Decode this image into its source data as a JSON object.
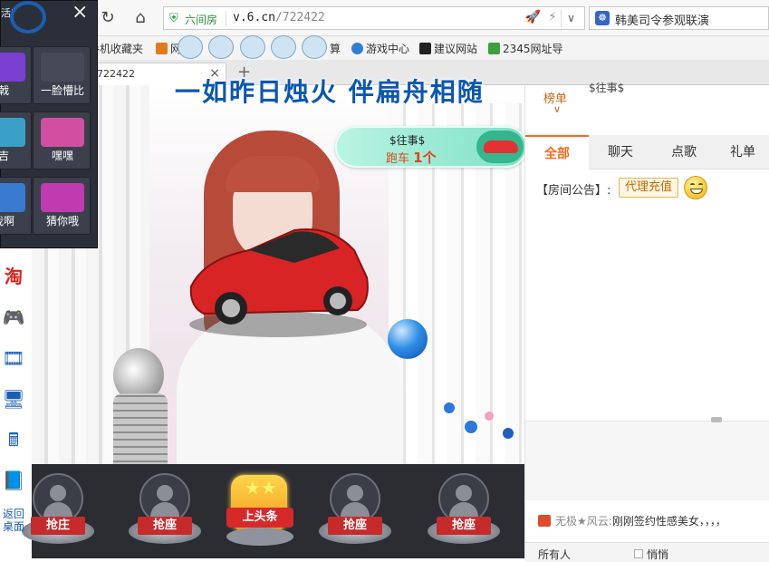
{
  "browser": {
    "site_badge": "六间房",
    "url_host": "v.6.cn",
    "url_path": "/722422",
    "search_text": "韩美司令参观联演",
    "tab_title": "722422"
  },
  "bookmarks": [
    {
      "label": "手机收藏夹",
      "color": "#888888"
    },
    {
      "label": "网",
      "color": "#e07b1a"
    },
    {
      "label": "算",
      "color": "#e07b1a"
    },
    {
      "label": "游戏中心",
      "color": "#2f7fd6"
    },
    {
      "label": "建议网站",
      "color": "#222222"
    },
    {
      "label": "2345网址导",
      "color": "#3ca03c"
    }
  ],
  "emoji_panel": {
    "title_fragment": "活)",
    "items": [
      {
        "caption": "戟",
        "color": "#7b3fd1"
      },
      {
        "caption": "一脸懵比",
        "color": "#e8e8e8"
      },
      {
        "caption": "吉",
        "color": "#3aa0c8"
      },
      {
        "caption": "嘿嘿",
        "color": "#d04fa0"
      },
      {
        "caption": "我啊",
        "color": "#3a7bd1"
      },
      {
        "caption": "猜你哦",
        "color": "#c03ab0"
      }
    ]
  },
  "stream": {
    "banner_title": "一如昨日烛火 伴扁舟相随",
    "race_user": "$往事$",
    "race_action": "跑车",
    "race_count": "1个"
  },
  "seats": [
    {
      "label": "抢庄"
    },
    {
      "label": "抢座"
    },
    {
      "label": "抢座"
    },
    {
      "label": "抢座"
    }
  ],
  "headline": {
    "label": "上头条"
  },
  "right_panel": {
    "rank_label": "榜单",
    "top_user": "$往事$",
    "tabs": [
      "全部",
      "聊天",
      "点歌",
      "礼单"
    ],
    "active_tab": 0,
    "notice_label": "【房间公告】:",
    "agent_button": "代理充值",
    "broadcast_user": "无极★风云:",
    "broadcast_text": "刚刚签约性感美女，，，，",
    "audience_select": "所有人",
    "whisper_label": "悄悄"
  },
  "sidebar_icons": [
    "taobao-icon",
    "gamepad-icon",
    "video-icon",
    "computer-icon",
    "calculator-icon",
    "notebook-icon"
  ],
  "sidebar_back": "返回桌面"
}
